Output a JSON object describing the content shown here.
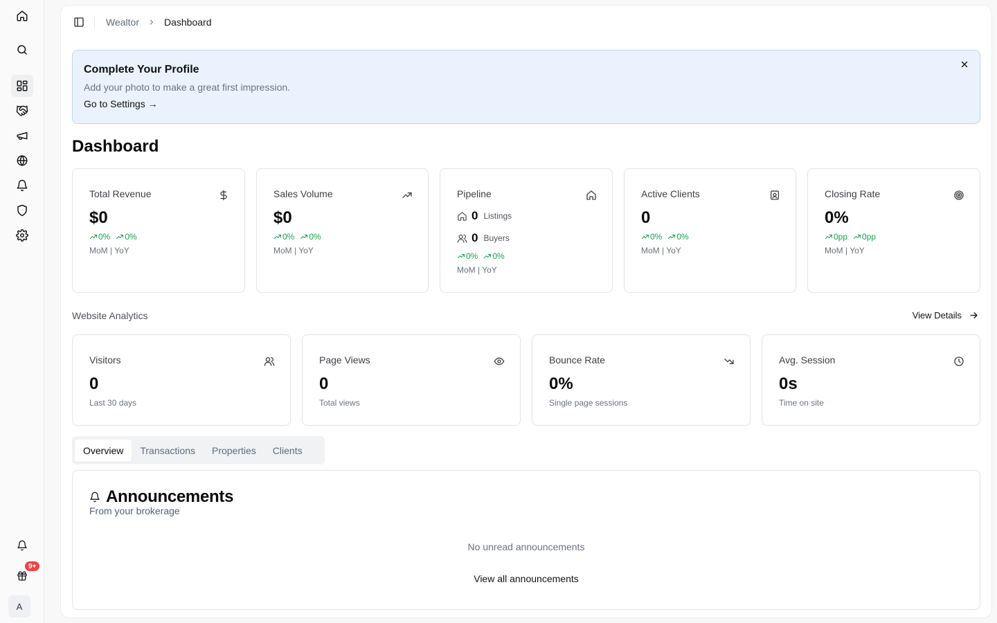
{
  "breadcrumb": {
    "root": "Wealtor",
    "current": "Dashboard"
  },
  "banner": {
    "title": "Complete Your Profile",
    "subtitle": "Add your photo to make a great first impression.",
    "link": "Go to Settings →"
  },
  "page_title": "Dashboard",
  "metrics": [
    {
      "label": "Total Revenue",
      "icon": "dollar-icon",
      "value": "$0",
      "mom": "0%",
      "yoy": "0%",
      "caption": "MoM | YoY"
    },
    {
      "label": "Sales Volume",
      "icon": "trending-up-icon",
      "value": "$0",
      "mom": "0%",
      "yoy": "0%",
      "caption": "MoM | YoY"
    },
    {
      "label": "Pipeline",
      "icon": "home-icon",
      "listings_value": "0",
      "listings_label": "Listings",
      "buyers_value": "0",
      "buyers_label": "Buyers",
      "mom": "0%",
      "yoy": "0%",
      "caption": "MoM | YoY"
    },
    {
      "label": "Active Clients",
      "icon": "contact-icon",
      "value": "0",
      "mom": "0%",
      "yoy": "0%",
      "caption": "MoM | YoY"
    },
    {
      "label": "Closing Rate",
      "icon": "target-icon",
      "value": "0%",
      "mom": "0pp",
      "yoy": "0pp",
      "caption": "MoM | YoY"
    }
  ],
  "analytics": {
    "section_label": "Website Analytics",
    "view_details": "View Details",
    "cards": [
      {
        "label": "Visitors",
        "icon": "users-icon",
        "value": "0",
        "caption": "Last 30 days"
      },
      {
        "label": "Page Views",
        "icon": "eye-icon",
        "value": "0",
        "caption": "Total views"
      },
      {
        "label": "Bounce Rate",
        "icon": "trending-down-icon",
        "value": "0%",
        "caption": "Single page sessions"
      },
      {
        "label": "Avg. Session",
        "icon": "clock-icon",
        "value": "0s",
        "caption": "Time on site"
      }
    ]
  },
  "tabs": [
    "Overview",
    "Transactions",
    "Properties",
    "Clients"
  ],
  "active_tab": "Overview",
  "announcements": {
    "title": "Announcements",
    "subtitle": "From your brokerage",
    "empty": "No unread announcements",
    "link": "View all announcements"
  },
  "rail": {
    "gift_badge": "9+",
    "avatar_initial": "A"
  },
  "colors": {
    "positive": "#16a34a",
    "banner_bg": "#eaf3fd",
    "banner_border": "#b9d6f5",
    "badge": "#ef4444"
  }
}
